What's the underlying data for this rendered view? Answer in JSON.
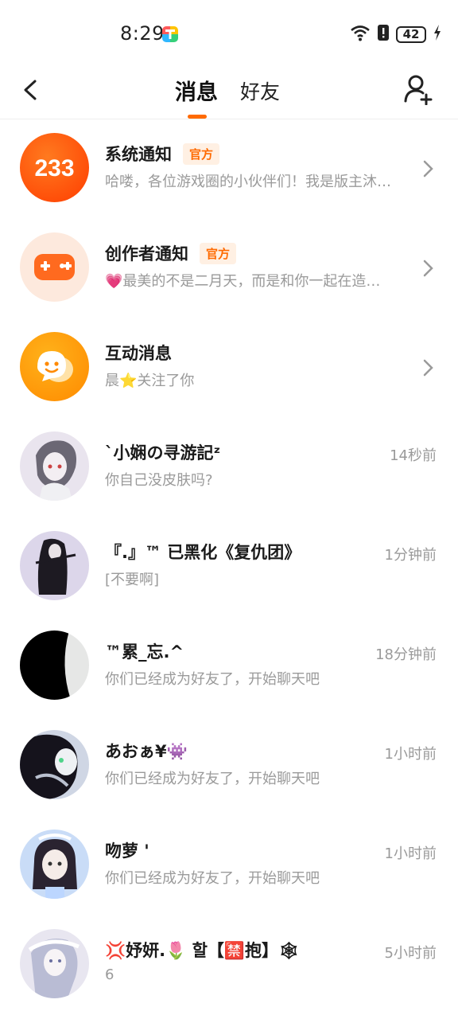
{
  "status_bar": {
    "time": "8:29",
    "battery": "42",
    "icons": [
      "wifi-icon",
      "alert-icon",
      "battery-icon",
      "charging-icon"
    ]
  },
  "nav": {
    "tabs": [
      {
        "label": "消息",
        "active": true
      },
      {
        "label": "好友",
        "active": false
      }
    ],
    "icons": [
      "back-arrow-icon",
      "add-friend-icon"
    ]
  },
  "colors": {
    "accent": "#ff6a00",
    "badge_bg": "#fff0e3",
    "secondary_text": "#9a9a9a"
  },
  "conversations": [
    {
      "title": "系统通知",
      "badge": "官方",
      "preview": "哈喽，各位游戏圈的小伙伴们！我是版主沐…",
      "time": "",
      "avatar": "233",
      "chevron": true
    },
    {
      "title": "创作者通知",
      "badge": "官方",
      "preview": "💗最美的不是二月天，而是和你一起在造…",
      "time": "",
      "avatar": "gamepad-icon",
      "chevron": true
    },
    {
      "title": "互动消息",
      "badge": "",
      "preview": "晨⭐关注了你",
      "time": "",
      "avatar": "chat-bubble-icon",
      "chevron": true
    },
    {
      "title": "`小娴の寻游記ᶻ",
      "badge": "",
      "preview": "你自己没皮肤吗?",
      "time": "14秒前",
      "avatar": "user-avatar",
      "chevron": false
    },
    {
      "title": "『.』™ 已黑化《复仇团》",
      "badge": "",
      "preview": "[不要啊]",
      "time": "1分钟前",
      "avatar": "user-avatar",
      "chevron": false
    },
    {
      "title": "™累_忘.^",
      "badge": "",
      "preview": "你们已经成为好友了，开始聊天吧",
      "time": "18分钟前",
      "avatar": "user-avatar",
      "chevron": false
    },
    {
      "title": "あおぁ¥👾",
      "badge": "",
      "preview": "你们已经成为好友了，开始聊天吧",
      "time": "1小时前",
      "avatar": "user-avatar",
      "chevron": false
    },
    {
      "title": "吻萝 '",
      "badge": "",
      "preview": "你们已经成为好友了，开始聊天吧",
      "time": "1小时前",
      "avatar": "user-avatar",
      "chevron": false
    },
    {
      "title": "💢妤妍.🌷 할【🈲抱】🕸",
      "badge": "",
      "preview": "6",
      "time": "5小时前",
      "avatar": "user-avatar",
      "chevron": false
    }
  ]
}
